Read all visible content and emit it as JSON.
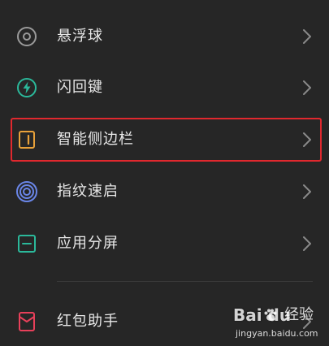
{
  "colors": {
    "background": "#262626",
    "text": "#e8e8e8",
    "chevron": "#8a8a8a",
    "highlight_border": "#e0282e",
    "floating_ball_icon": "#9a9a9a",
    "flash_key_icon": "#2bb89a",
    "smart_sidebar_icon": "#e8a13a",
    "fingerprint_icon": "#6a86e8",
    "split_screen_icon": "#2bb89a",
    "red_packet_icon": "#e8405a"
  },
  "menu": {
    "items": [
      {
        "id": "floating-ball",
        "label": "悬浮球",
        "icon": "floating-ball-icon"
      },
      {
        "id": "flash-key",
        "label": "闪回键",
        "icon": "lightning-icon"
      },
      {
        "id": "smart-sidebar",
        "label": "智能侧边栏",
        "icon": "sidebar-icon",
        "highlighted": true
      },
      {
        "id": "fingerprint",
        "label": "指纹速启",
        "icon": "fingerprint-icon"
      },
      {
        "id": "split-screen",
        "label": "应用分屏",
        "icon": "split-screen-icon"
      },
      {
        "id": "red-packet",
        "label": "红包助手",
        "icon": "red-envelope-icon"
      }
    ]
  },
  "watermark": {
    "logo": "Bai du",
    "jingyan": "经验",
    "url": "jingyan.baidu.com"
  }
}
